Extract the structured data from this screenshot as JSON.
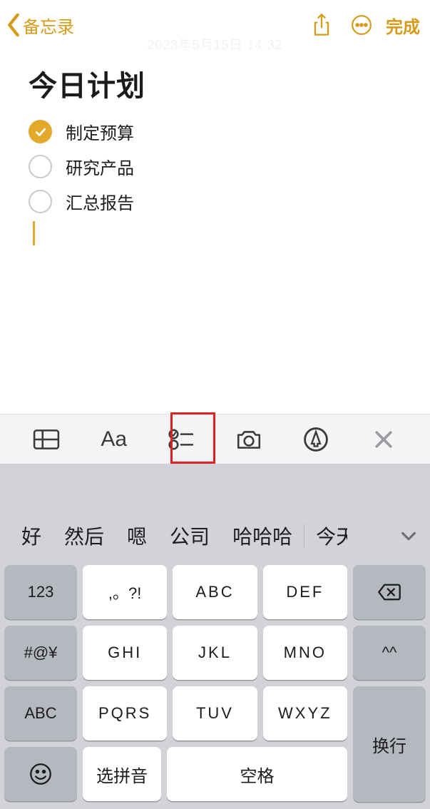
{
  "nav": {
    "back_label": "备忘录",
    "done_label": "完成"
  },
  "timestamp": "2023年5月15日 14:32",
  "note": {
    "title": "今日计划",
    "items": [
      {
        "checked": true,
        "label": "制定预算"
      },
      {
        "checked": false,
        "label": "研究产品"
      },
      {
        "checked": false,
        "label": "汇总报告"
      }
    ]
  },
  "format_bar": {
    "aa_label": "Aa",
    "highlighted_tool": "checklist"
  },
  "keyboard": {
    "candidates": [
      "好",
      "然后",
      "嗯",
      "公司",
      "哈哈哈",
      "今天"
    ],
    "row1_side": "123",
    "row1": [
      ",。?!",
      "ABC",
      "DEF"
    ],
    "row2_side": "#@¥",
    "row2": [
      "GHI",
      "JKL",
      "MNO"
    ],
    "row2_right": "^^",
    "row3_side": "ABC",
    "row3": [
      "PQRS",
      "TUV",
      "WXYZ"
    ],
    "row4": {
      "pinyin": "选拼音",
      "space": "空格",
      "enter": "换行"
    }
  }
}
